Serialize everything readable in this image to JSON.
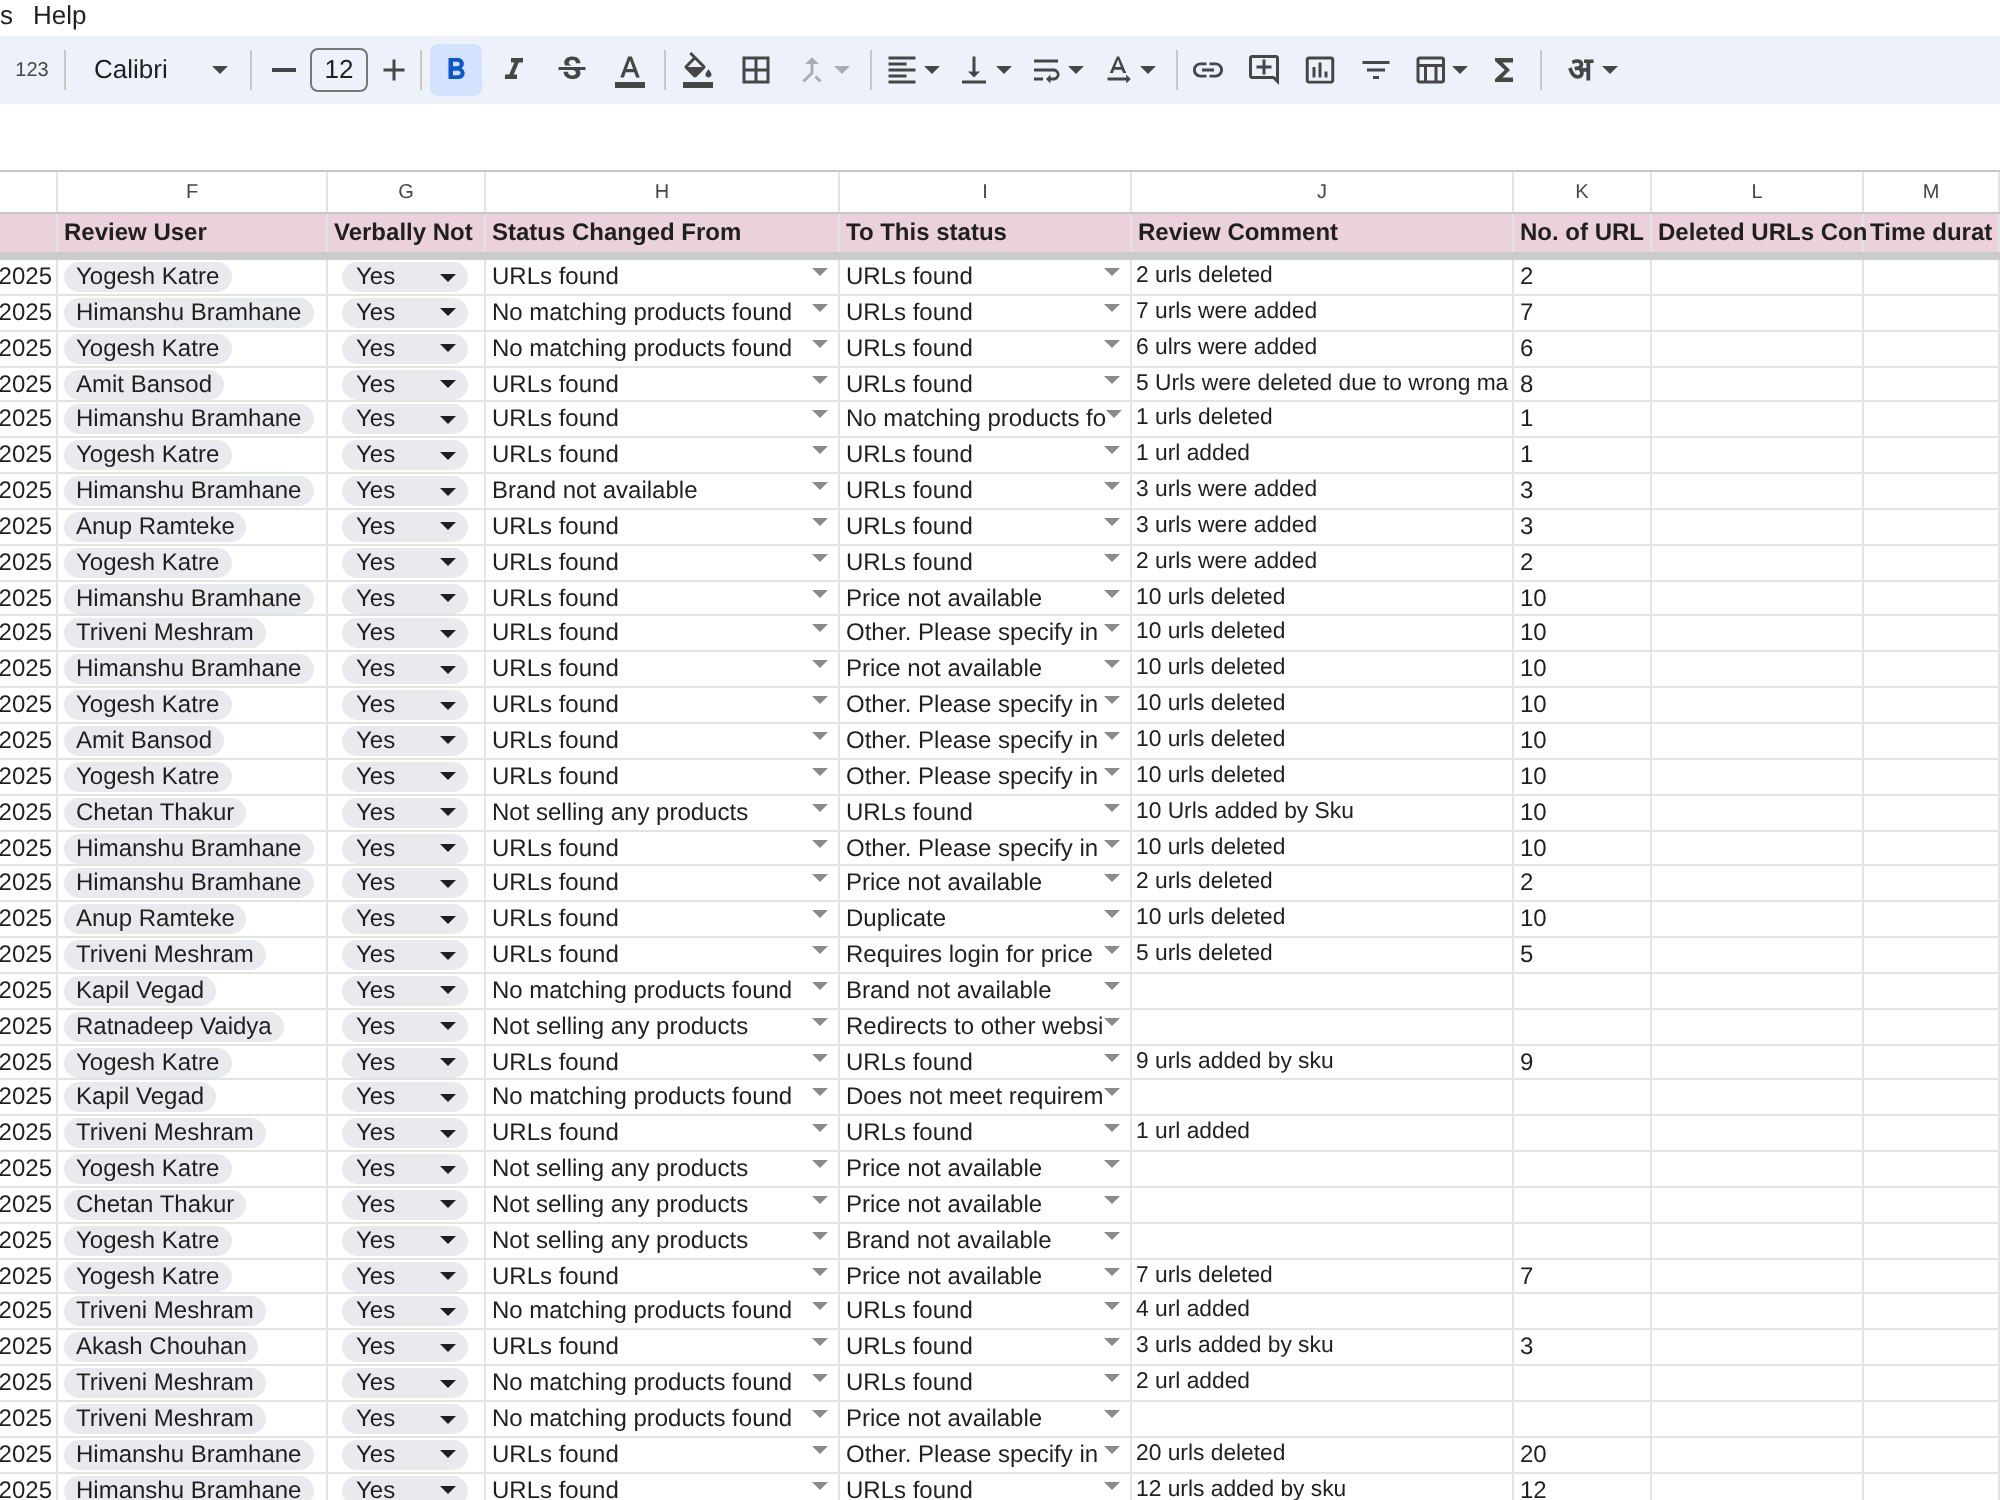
{
  "menu_bar": [
    "s",
    "Help"
  ],
  "toolbar": {
    "number_format": "123",
    "font": "Calibri",
    "font_size": "12",
    "format_toggles": [
      {
        "kind": "bold",
        "on": true
      },
      {
        "kind": "italic",
        "on": false
      },
      {
        "kind": "strikethrough",
        "on": false
      }
    ],
    "merge": {
      "disabled": true
    },
    "input_tools": "अ"
  },
  "column_letters": [
    "F",
    "G",
    "H",
    "I",
    "J",
    "K",
    "L",
    "M"
  ],
  "header_row": [
    "Review User",
    "Verbally Not",
    "Status Changed From",
    "To This status",
    "Review Comment",
    "No. of URL",
    "Deleted URLs Con",
    "Time durat"
  ],
  "rows": [
    {
      "column_e": "2025",
      "review_user": "Yogesh Katre",
      "verbally_not": "Yes",
      "status_changed_from": "URLs found",
      "to_this_status": "URLs found",
      "review_comment": "2 urls deleted",
      "no_of_url": "2"
    },
    {
      "column_e": "2025",
      "review_user": "Himanshu Bramhane",
      "verbally_not": "Yes",
      "status_changed_from": "No matching products found",
      "to_this_status": "URLs found",
      "review_comment": "7 urls were added",
      "no_of_url": "7"
    },
    {
      "column_e": "2025",
      "review_user": "Yogesh Katre",
      "verbally_not": "Yes",
      "status_changed_from": "No matching products found",
      "to_this_status": "URLs found",
      "review_comment": "6 ulrs were added",
      "no_of_url": "6"
    },
    {
      "column_e": "2025",
      "review_user": "Amit Bansod",
      "verbally_not": "Yes",
      "status_changed_from": "URLs found",
      "to_this_status": "URLs found",
      "review_comment": "5 Urls were deleted due to wrong ma",
      "no_of_url": "8"
    },
    {
      "column_e": "2025",
      "review_user": "Himanshu Bramhane",
      "verbally_not": "Yes",
      "status_changed_from": "URLs found",
      "to_this_status": "No matching products fo",
      "review_comment": "1 urls deleted",
      "no_of_url": "1"
    },
    {
      "column_e": "2025",
      "review_user": "Yogesh Katre",
      "verbally_not": "Yes",
      "status_changed_from": "URLs found",
      "to_this_status": "URLs found",
      "review_comment": "1 url added",
      "no_of_url": "1"
    },
    {
      "column_e": "2025",
      "review_user": "Himanshu Bramhane",
      "verbally_not": "Yes",
      "status_changed_from": "Brand not available",
      "to_this_status": "URLs found",
      "review_comment": "3 urls were added",
      "no_of_url": "3"
    },
    {
      "column_e": "2025",
      "review_user": "Anup Ramteke",
      "verbally_not": "Yes",
      "status_changed_from": "URLs found",
      "to_this_status": "URLs found",
      "review_comment": "3 urls were added",
      "no_of_url": "3"
    },
    {
      "column_e": "2025",
      "review_user": "Yogesh Katre",
      "verbally_not": "Yes",
      "status_changed_from": "URLs found",
      "to_this_status": "URLs found",
      "review_comment": "2 urls were added",
      "no_of_url": "2"
    },
    {
      "column_e": "2025",
      "review_user": "Himanshu Bramhane",
      "verbally_not": "Yes",
      "status_changed_from": "URLs found",
      "to_this_status": "Price not available",
      "review_comment": "10 urls deleted",
      "no_of_url": "10"
    },
    {
      "column_e": "2025",
      "review_user": "Triveni Meshram",
      "verbally_not": "Yes",
      "status_changed_from": "URLs found",
      "to_this_status": "Other. Please specify in",
      "review_comment": "10 urls deleted",
      "no_of_url": "10"
    },
    {
      "column_e": "2025",
      "review_user": "Himanshu Bramhane",
      "verbally_not": "Yes",
      "status_changed_from": "URLs found",
      "to_this_status": "Price not available",
      "review_comment": "10 urls deleted",
      "no_of_url": "10"
    },
    {
      "column_e": "2025",
      "review_user": "Yogesh Katre",
      "verbally_not": "Yes",
      "status_changed_from": "URLs found",
      "to_this_status": "Other. Please specify in",
      "review_comment": "10 urls deleted",
      "no_of_url": "10"
    },
    {
      "column_e": "2025",
      "review_user": "Amit Bansod",
      "verbally_not": "Yes",
      "status_changed_from": "URLs found",
      "to_this_status": "Other. Please specify in",
      "review_comment": "10 urls deleted",
      "no_of_url": "10"
    },
    {
      "column_e": "2025",
      "review_user": "Yogesh Katre",
      "verbally_not": "Yes",
      "status_changed_from": "URLs found",
      "to_this_status": "Other. Please specify in",
      "review_comment": "10 urls deleted",
      "no_of_url": "10"
    },
    {
      "column_e": "2025",
      "review_user": "Chetan Thakur",
      "verbally_not": "Yes",
      "status_changed_from": "Not selling any products",
      "to_this_status": "URLs found",
      "review_comment": "10 Urls added by Sku",
      "no_of_url": "10"
    },
    {
      "column_e": "2025",
      "review_user": "Himanshu Bramhane",
      "verbally_not": "Yes",
      "status_changed_from": "URLs found",
      "to_this_status": "Other. Please specify in",
      "review_comment": "10 urls deleted",
      "no_of_url": "10"
    },
    {
      "column_e": "2025",
      "review_user": "Himanshu Bramhane",
      "verbally_not": "Yes",
      "status_changed_from": "URLs found",
      "to_this_status": "Price not available",
      "review_comment": "2 urls deleted",
      "no_of_url": "2"
    },
    {
      "column_e": "2025",
      "review_user": "Anup Ramteke",
      "verbally_not": "Yes",
      "status_changed_from": "URLs found",
      "to_this_status": "Duplicate",
      "review_comment": "10 urls deleted",
      "no_of_url": "10"
    },
    {
      "column_e": "2025",
      "review_user": "Triveni Meshram",
      "verbally_not": "Yes",
      "status_changed_from": "URLs found",
      "to_this_status": "Requires login for price",
      "review_comment": "5 urls deleted",
      "no_of_url": "5"
    },
    {
      "column_e": "2025",
      "review_user": "Kapil Vegad",
      "verbally_not": "Yes",
      "status_changed_from": "No matching products found",
      "to_this_status": "Brand not available"
    },
    {
      "column_e": "2025",
      "review_user": "Ratnadeep Vaidya",
      "verbally_not": "Yes",
      "status_changed_from": "Not selling any products",
      "to_this_status": "Redirects to other websi"
    },
    {
      "column_e": "2025",
      "review_user": "Yogesh Katre",
      "verbally_not": "Yes",
      "status_changed_from": "URLs found",
      "to_this_status": "URLs found",
      "review_comment": "9 urls added by sku",
      "no_of_url": "9"
    },
    {
      "column_e": "2025",
      "review_user": "Kapil Vegad",
      "verbally_not": "Yes",
      "status_changed_from": "No matching products found",
      "to_this_status": "Does not meet requirem"
    },
    {
      "column_e": "2025",
      "review_user": "Triveni Meshram",
      "verbally_not": "Yes",
      "status_changed_from": "URLs found",
      "to_this_status": "URLs found",
      "review_comment": "1 url added"
    },
    {
      "column_e": "2025",
      "review_user": "Yogesh Katre",
      "verbally_not": "Yes",
      "status_changed_from": "Not selling any products",
      "to_this_status": "Price not available"
    },
    {
      "column_e": "2025",
      "review_user": "Chetan Thakur",
      "verbally_not": "Yes",
      "status_changed_from": "Not selling any products",
      "to_this_status": "Price not available"
    },
    {
      "column_e": "2025",
      "review_user": "Yogesh Katre",
      "verbally_not": "Yes",
      "status_changed_from": "Not selling any products",
      "to_this_status": "Brand not available"
    },
    {
      "column_e": "2025",
      "review_user": "Yogesh Katre",
      "verbally_not": "Yes",
      "status_changed_from": "URLs found",
      "to_this_status": "Price not available",
      "review_comment": "7 urls deleted",
      "no_of_url": "7"
    },
    {
      "column_e": "2025",
      "review_user": "Triveni Meshram",
      "verbally_not": "Yes",
      "status_changed_from": "No matching products found",
      "to_this_status": "URLs found",
      "review_comment": "4 url added"
    },
    {
      "column_e": "2025",
      "review_user": "Akash Chouhan",
      "verbally_not": "Yes",
      "status_changed_from": "URLs found",
      "to_this_status": "URLs found",
      "review_comment": "3 urls added by sku",
      "no_of_url": "3"
    },
    {
      "column_e": "2025",
      "review_user": "Triveni Meshram",
      "verbally_not": "Yes",
      "status_changed_from": "No matching products found",
      "to_this_status": "URLs found",
      "review_comment": "2 url added"
    },
    {
      "column_e": "2025",
      "review_user": "Triveni Meshram",
      "verbally_not": "Yes",
      "status_changed_from": "No matching products found",
      "to_this_status": "Price not available"
    },
    {
      "column_e": "2025",
      "review_user": "Himanshu Bramhane",
      "verbally_not": "Yes",
      "status_changed_from": "URLs found",
      "to_this_status": "Other. Please specify in",
      "review_comment": "20 urls deleted",
      "no_of_url": "20"
    },
    {
      "column_e": "2025",
      "review_user": "Himanshu Bramhane",
      "verbally_not": "Yes",
      "status_changed_from": "URLs found",
      "to_this_status": "URLs found",
      "review_comment": "12 urls added by sku",
      "no_of_url": "12"
    }
  ]
}
